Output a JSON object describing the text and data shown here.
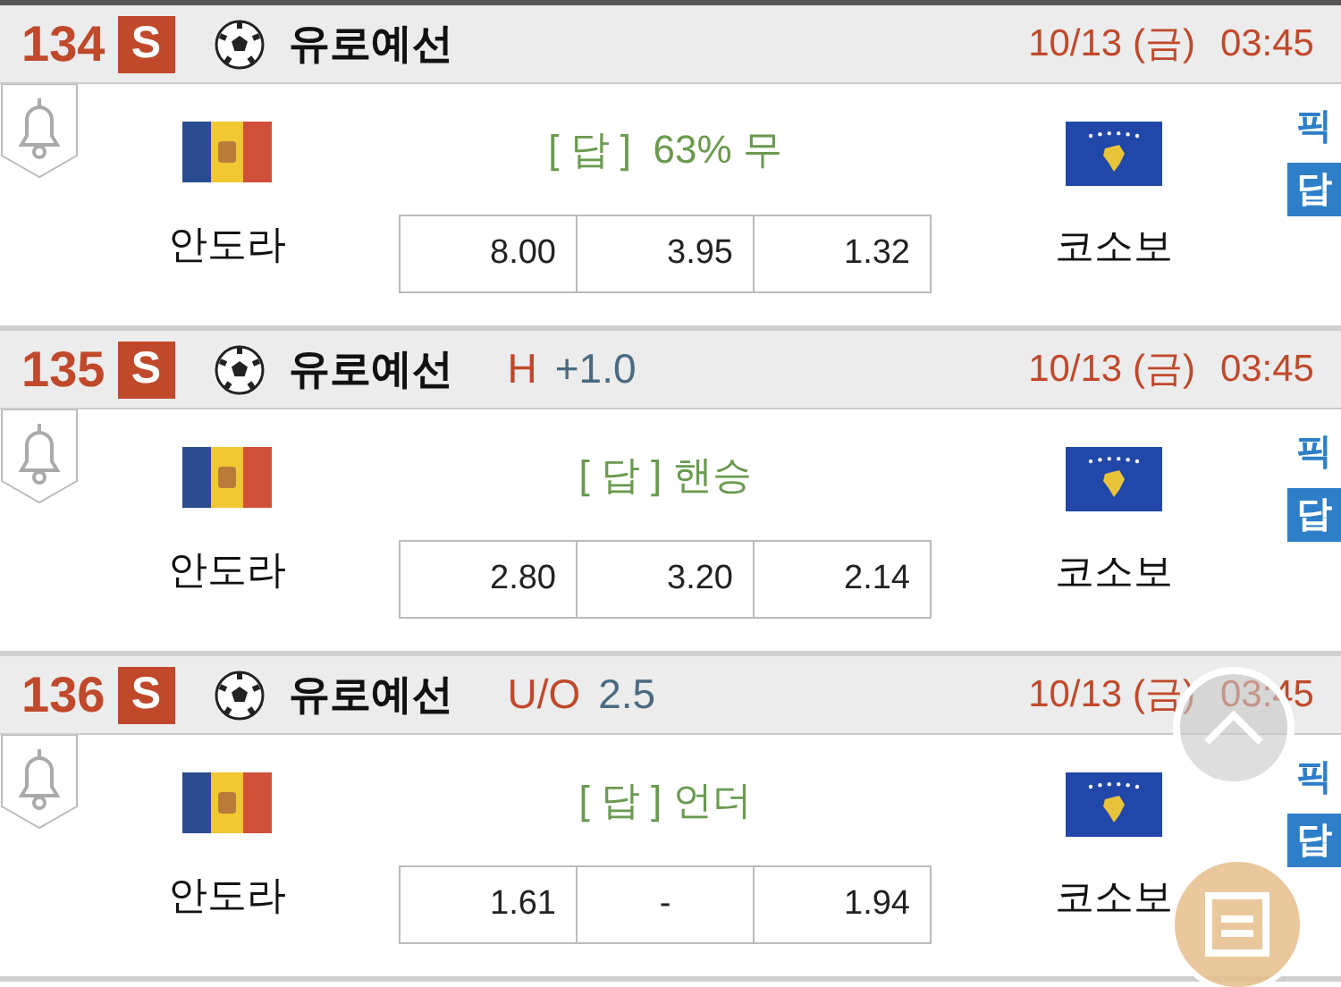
{
  "matches": [
    {
      "number": "134",
      "badge": "S",
      "league": "유로예선",
      "date": "10/13 (금)",
      "time": "03:45",
      "answer": "[ 답 ]  63% 무",
      "home": "안도라",
      "away": "코소보",
      "odds": [
        {
          "kind": "value",
          "text": "8.00"
        },
        {
          "kind": "value",
          "text": "3.95"
        },
        {
          "kind": "value",
          "text": "1.32"
        }
      ],
      "pick": "픽",
      "answer_badge": "답"
    },
    {
      "number": "135",
      "badge": "S",
      "league": "유로예선",
      "handicap": {
        "type": "H",
        "value": "+1.0"
      },
      "date": "10/13 (금)",
      "time": "03:45",
      "answer": "[ 답 ] 핸승",
      "home": "안도라",
      "away": "코소보",
      "odds": [
        {
          "kind": "value",
          "text": "2.80"
        },
        {
          "kind": "value",
          "text": "3.20"
        },
        {
          "kind": "value",
          "text": "2.14"
        }
      ],
      "pick": "픽",
      "answer_badge": "답"
    },
    {
      "number": "136",
      "badge": "S",
      "league": "유로예선",
      "handicap": {
        "type": "U/O",
        "value": "2.5"
      },
      "date": "10/13 (금)",
      "time": "03:45",
      "answer": "[ 답 ] 언더",
      "home": "안도라",
      "away": "코소보",
      "odds": [
        {
          "kind": "value",
          "text": "1.61"
        },
        {
          "kind": "none",
          "text": "-"
        },
        {
          "kind": "value",
          "text": "1.94"
        }
      ],
      "pick": "픽",
      "answer_badge": "답"
    }
  ]
}
